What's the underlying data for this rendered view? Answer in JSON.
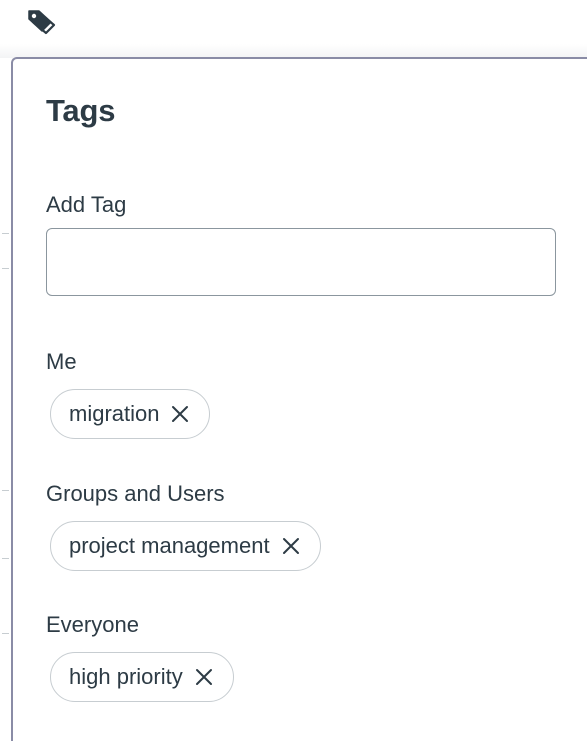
{
  "panel": {
    "title": "Tags",
    "add_tag_label": "Add Tag",
    "add_tag_value": "",
    "add_tag_placeholder": ""
  },
  "sections": {
    "me": {
      "label": "Me",
      "tags": [
        "migration"
      ]
    },
    "groups_and_users": {
      "label": "Groups and Users",
      "tags": [
        "project management"
      ]
    },
    "everyone": {
      "label": "Everyone",
      "tags": [
        "high priority"
      ]
    }
  },
  "icons": {
    "toolbar": "tag-icon",
    "remove": "close-icon"
  },
  "colors": {
    "text": "#2d3b45",
    "panel_border": "#8a8ca6",
    "pill_border": "#c7cdd1",
    "input_border": "#8b969e"
  }
}
